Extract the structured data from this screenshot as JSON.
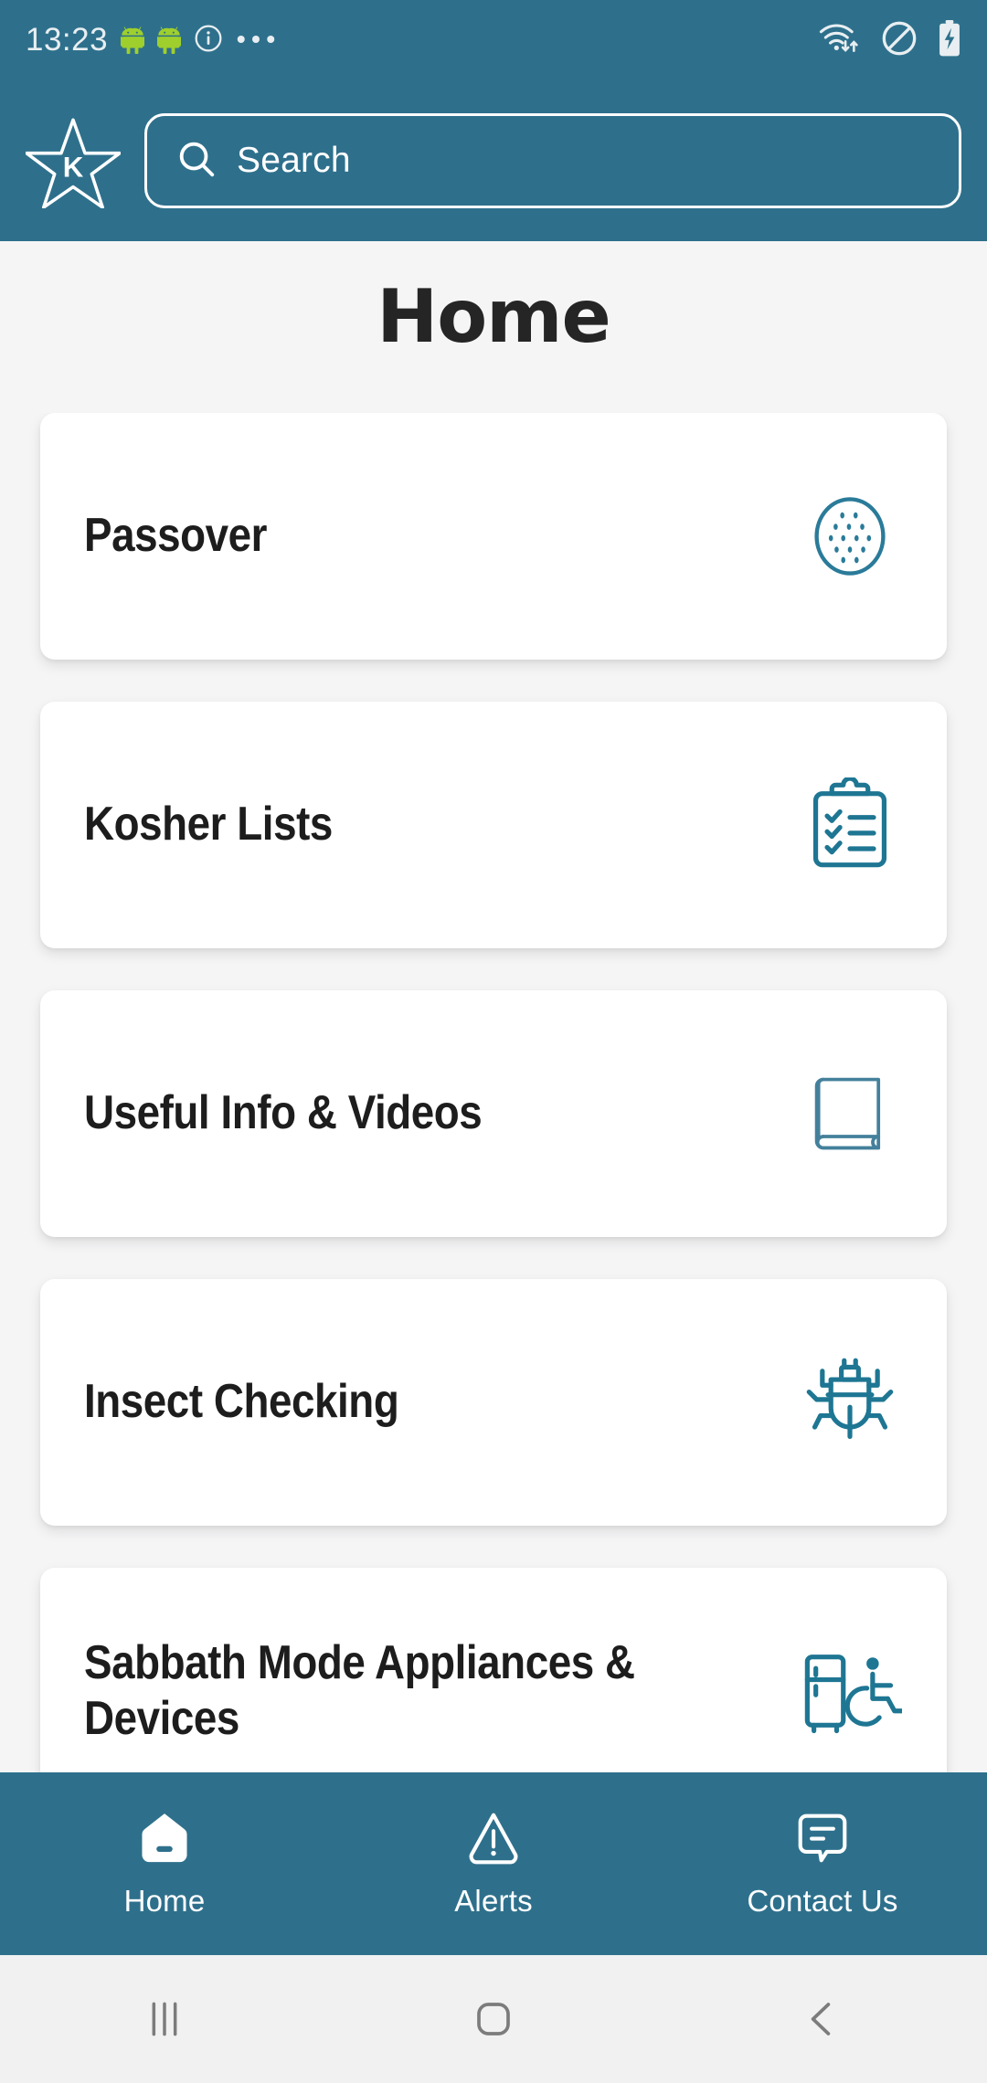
{
  "status_bar": {
    "time": "13:23",
    "left_icons": [
      "android-bot-icon",
      "android-bot-icon",
      "info-circle-icon"
    ],
    "right_icons": [
      "wifi-transfer-icon",
      "do-not-disturb-icon",
      "battery-charging-icon"
    ],
    "background_color": "#2E708C",
    "text_color": "#E8EEF1"
  },
  "app_bar": {
    "logo_icon": "star-k-logo-icon",
    "logo_letter": "K",
    "search": {
      "icon": "search-icon",
      "value": "",
      "placeholder": "Search"
    },
    "background_color": "#2E708C"
  },
  "page": {
    "title": "Home",
    "background_color": "#F5F5F6",
    "title_color": "#252525"
  },
  "cards": [
    {
      "label": "Passover",
      "icon": "matzah-icon"
    },
    {
      "label": "Kosher Lists",
      "icon": "clipboard-checklist-icon"
    },
    {
      "label": "Useful Info & Videos",
      "icon": "book-icon"
    },
    {
      "label": "Insect Checking",
      "icon": "bug-icon"
    },
    {
      "label": "Sabbath Mode Appliances & Devices",
      "icon": "refrigerator-accessibility-icon"
    }
  ],
  "card_style": {
    "background_color": "#FFFFFF",
    "label_color": "#1D1D1D",
    "icon_color": "#2A7B99"
  },
  "bottom_nav": {
    "background_color": "#2E708C",
    "active_index": 0,
    "items": [
      {
        "label": "Home",
        "icon": "home-filled-icon"
      },
      {
        "label": "Alerts",
        "icon": "warning-triangle-icon"
      },
      {
        "label": "Contact Us",
        "icon": "message-bubble-icon"
      }
    ]
  },
  "system_nav": {
    "background_color": "#F1F1F1",
    "icon_color": "#7C7C7C",
    "buttons": [
      {
        "name": "recents",
        "icon": "recents-bars-icon"
      },
      {
        "name": "home",
        "icon": "home-square-icon"
      },
      {
        "name": "back",
        "icon": "back-chevron-icon"
      }
    ]
  }
}
